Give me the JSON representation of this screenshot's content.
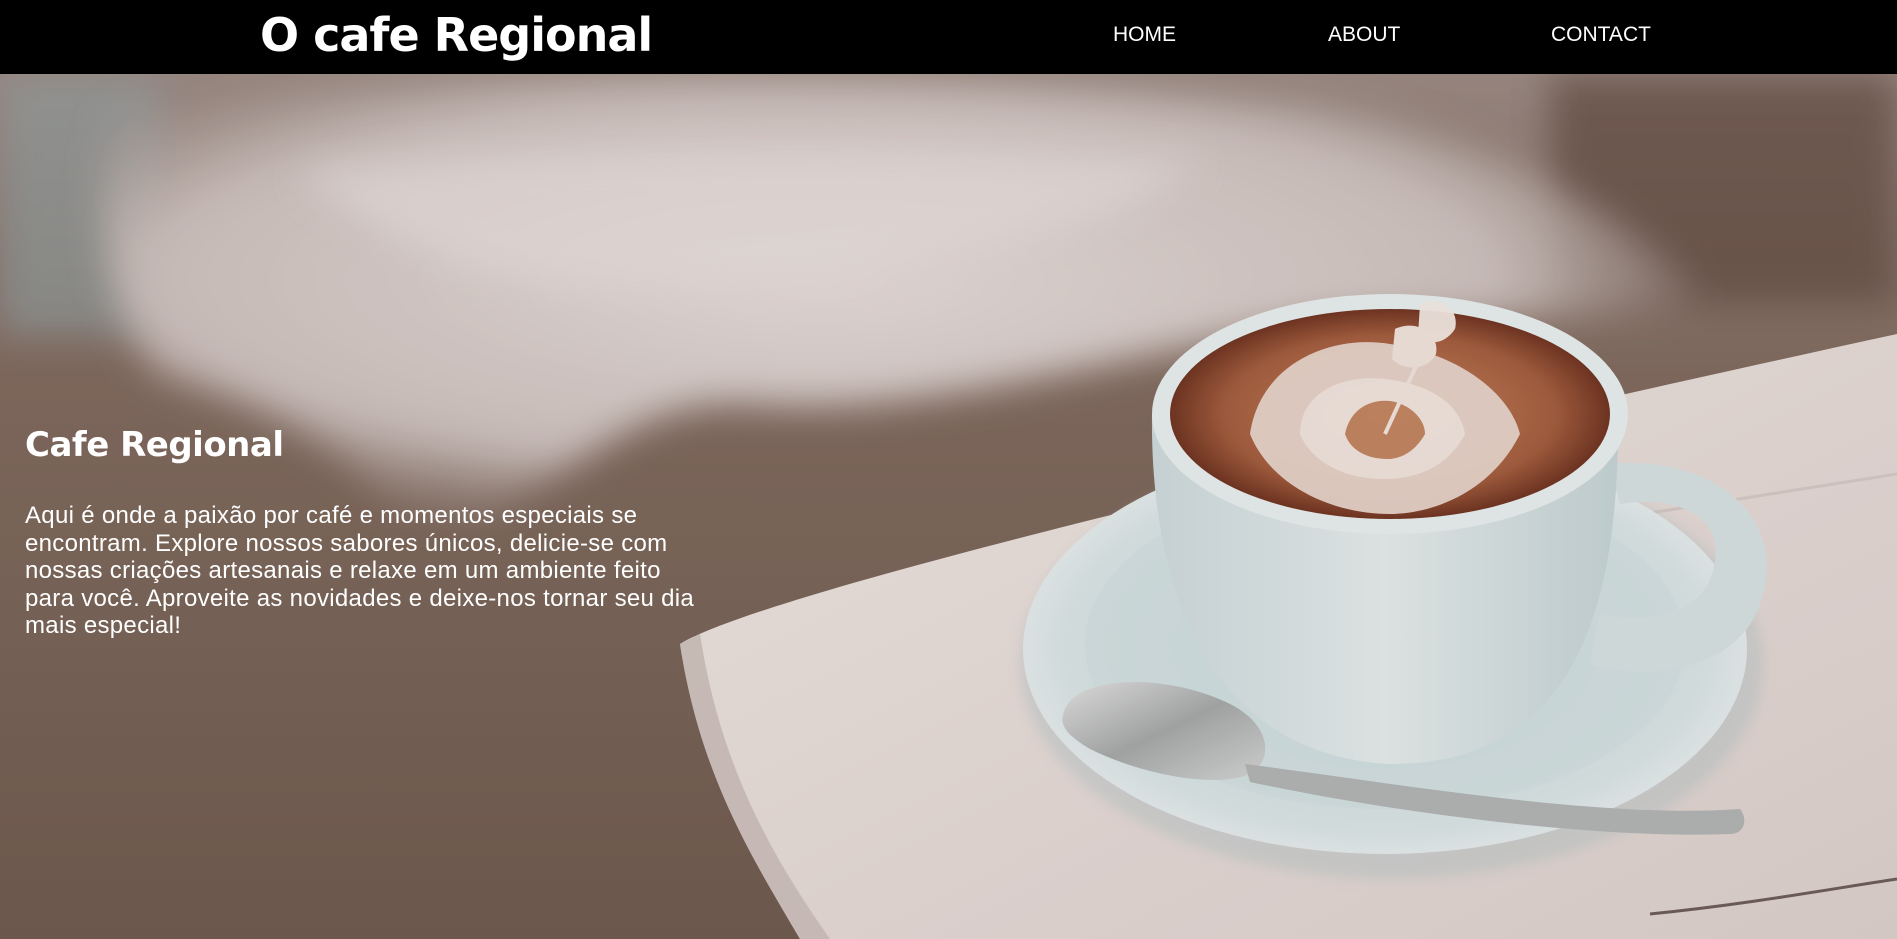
{
  "header": {
    "brand": "O cafe Regional",
    "nav": {
      "home": "HOME",
      "about": "ABOUT",
      "contact": "CONTACT"
    }
  },
  "hero": {
    "title": "Cafe Regional",
    "text": "Aqui é onde a paixão por café e momentos especiais se encontram. Explore nossos sabores únicos, delicie-se com nossas criações artesanais e relaxe em um ambiente feito para você. Aproveite as novidades e deixe-nos tornar seu dia mais especial!",
    "background": "cappuccino-latte-art-photo"
  },
  "colors": {
    "navbar": "#000000",
    "text": "#ffffff",
    "floor": "#7a6458",
    "table": "#ece3e0",
    "cup": "#dfe9ea",
    "coffee": "#a0583c"
  }
}
